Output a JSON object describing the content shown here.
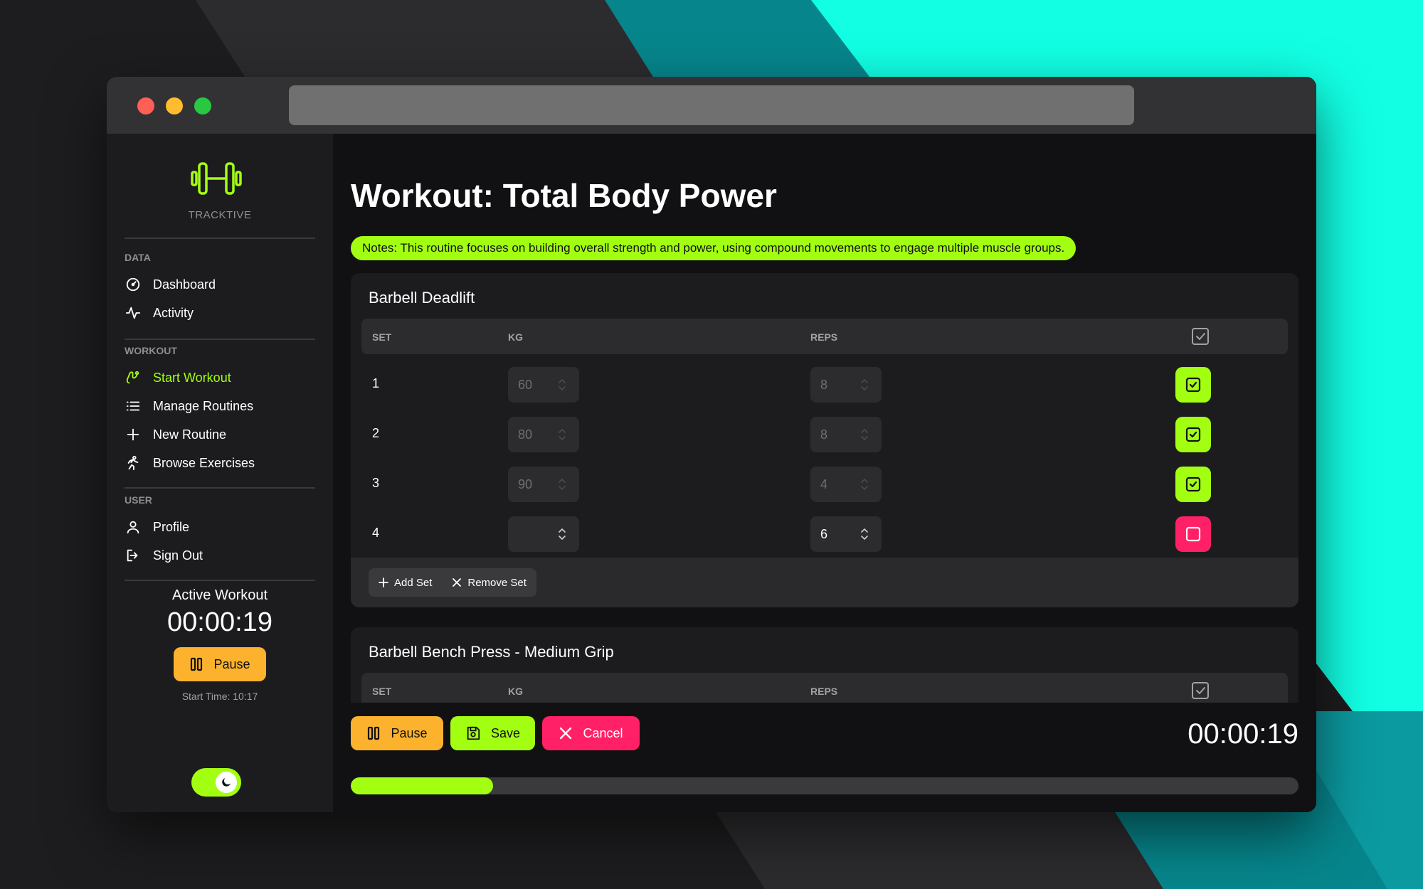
{
  "app": {
    "brand": "TRACKTIVE",
    "colors": {
      "accent": "#a3ff12",
      "warning": "#fcb22c",
      "danger": "#ff2067",
      "window": "#111113"
    }
  },
  "sidebar": {
    "sections": [
      {
        "label": "DATA",
        "items": [
          {
            "label": "Dashboard",
            "icon": "gauge-icon"
          },
          {
            "label": "Activity",
            "icon": "activity-icon"
          }
        ]
      },
      {
        "label": "WORKOUT",
        "items": [
          {
            "label": "Start Workout",
            "icon": "route-icon",
            "active": true
          },
          {
            "label": "Manage Routines",
            "icon": "list-icon"
          },
          {
            "label": "New Routine",
            "icon": "plus-icon"
          },
          {
            "label": "Browse Exercises",
            "icon": "running-icon"
          }
        ]
      },
      {
        "label": "USER",
        "items": [
          {
            "label": "Profile",
            "icon": "user-icon"
          },
          {
            "label": "Sign Out",
            "icon": "sign-out-icon"
          }
        ]
      }
    ],
    "active_workout": {
      "title": "Active Workout",
      "timer": "00:00:19",
      "pause_label": "Pause",
      "start_time": "Start Time: 10:17"
    },
    "dark_mode_on": true
  },
  "main": {
    "title": "Workout: Total Body Power",
    "notes": "Notes: This routine focuses on building overall strength and power, using compound movements to engage multiple muscle groups.",
    "columns": {
      "set": "SET",
      "kg": "KG",
      "reps": "REPS"
    },
    "exercises": [
      {
        "name": "Barbell Deadlift",
        "sets": [
          {
            "set": "1",
            "kg": "60",
            "reps": "8",
            "done": true
          },
          {
            "set": "2",
            "kg": "80",
            "reps": "8",
            "done": true
          },
          {
            "set": "3",
            "kg": "90",
            "reps": "4",
            "done": true
          },
          {
            "set": "4",
            "kg": "",
            "reps": "6",
            "done": false
          }
        ],
        "add_set_label": "Add Set",
        "remove_set_label": "Remove Set"
      },
      {
        "name": "Barbell Bench Press - Medium Grip"
      }
    ]
  },
  "bottom_bar": {
    "pause_label": "Pause",
    "save_label": "Save",
    "cancel_label": "Cancel",
    "timer": "00:00:19",
    "progress_fraction": 0.15
  }
}
